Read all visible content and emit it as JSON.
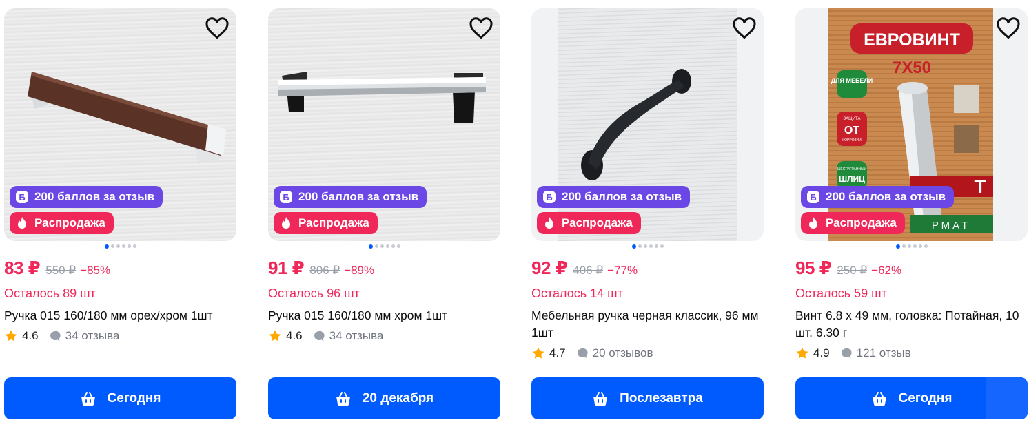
{
  "products": [
    {
      "price": "83 ₽",
      "old_price": "550 ₽",
      "discount": "−85%",
      "stock": "Осталось 89 шт",
      "title": "Ручка 015 160/180 мм орех/хром 1шт",
      "rating": "4.6",
      "reviews": "34 отзыва",
      "points_badge": "200 баллов за отзыв",
      "sale_badge": "Распродажа",
      "delivery": "Сегодня"
    },
    {
      "price": "91 ₽",
      "old_price": "806 ₽",
      "discount": "−89%",
      "stock": "Осталось 96 шт",
      "title": "Ручка 015 160/180 мм хром 1шт",
      "rating": "4.6",
      "reviews": "34 отзыва",
      "points_badge": "200 баллов за отзыв",
      "sale_badge": "Распродажа",
      "delivery": "20 декабря"
    },
    {
      "price": "92 ₽",
      "old_price": "406 ₽",
      "discount": "−77%",
      "stock": "Осталось 14 шт",
      "title": "Мебельная ручка черная классик, 96 мм 1шт",
      "rating": "4.7",
      "reviews": "20 отзывов",
      "points_badge": "200 баллов за отзыв",
      "sale_badge": "Распродажа",
      "delivery": "Послезавтра"
    },
    {
      "price": "95 ₽",
      "old_price": "250 ₽",
      "discount": "−62%",
      "stock": "Осталось 59 шт",
      "title": "Винт 6.8 х 49 мм, головка: Потайная, 10 шт. 6.30 г",
      "rating": "4.9",
      "reviews": "121 отзыв",
      "points_badge": "200 баллов за отзыв",
      "sale_badge": "Распродажа",
      "delivery": "Сегодня",
      "image_text": {
        "headline": "ЕВРОВИНТ",
        "size": "7X50",
        "tag1": "ДЛЯ МЕБЕЛИ",
        "tag2_small": "ЗАЩИТА",
        "tag2_big": "ОТ",
        "tag2_sub": "КОРРОЗИИ",
        "tag3_small": "ШЕСТИГРАННЫЙ",
        "tag3_big": "ШЛИЦ",
        "footer": "РМАТ",
        "partial": "Т"
      }
    }
  ],
  "icons": {
    "favorite": "heart-outline-icon",
    "points": "b-coin-icon",
    "sale": "flame-icon",
    "rating": "star-icon",
    "reviews": "chat-bubble-icon",
    "cart": "basket-icon"
  },
  "colors": {
    "accent_blue": "#005bff",
    "sale_pink": "#f0285a",
    "points_purple": "#6b47e6",
    "star_orange": "#ffa800",
    "muted_gray": "#70757f"
  }
}
